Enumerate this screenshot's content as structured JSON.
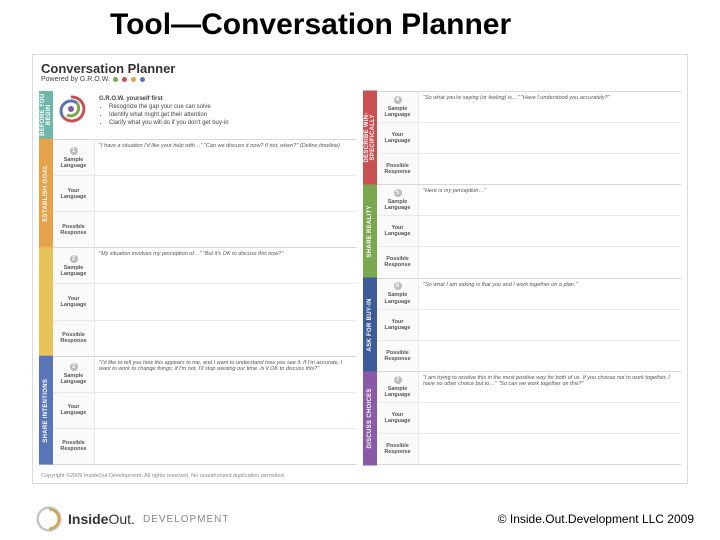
{
  "slide": {
    "title": "Tool—Conversation Planner"
  },
  "doc": {
    "header_title": "Conversation Planner",
    "header_sub": "Powered by G.R.O.W.",
    "intro_title": "G.R.O.W. yourself first",
    "intro_b1": "Recognize the gap your cue can solve",
    "intro_b2": "Identify what might get their attention",
    "intro_b3": "Clarify what you will do if you don't get buy-in",
    "before_label": "BEFORE YOU BEGIN",
    "labels": {
      "sample": "Sample Language",
      "your": "Your Language",
      "possible": "Possible Response"
    },
    "left": [
      {
        "num": "1",
        "tab": "ESTABLISH GOAL",
        "color": "c-orange",
        "sample": "\"I have a situation I'd like your help with…\"  \"Can we discuss it now? If not, when?\" (Define timeline)"
      },
      {
        "num": "2",
        "tab": "",
        "color": "c-yellow",
        "sample": "\"My situation involves my perception of…\"  \"But it's OK to discuss this now?\""
      },
      {
        "num": "3",
        "tab": "SHARE INTENTIONS",
        "color": "c-blue",
        "sample": "\"I'd like to tell you how this appears to me, and I want to understand how you see it. If I'm accurate, I want to work to change things; if I'm not, I'll stop wasting our time. Is it OK to discuss this?\""
      }
    ],
    "right": [
      {
        "num": "4",
        "tab": "DESCRIBE WIN-SPECIFICALLY",
        "color": "c-red",
        "sample": "\"So what you're saying (or feeling) is…\"  \"Have I understood you accurately?\""
      },
      {
        "num": "5",
        "tab": "SHARE REALITY",
        "color": "c-green",
        "sample": "\"Here is my perception…\""
      },
      {
        "num": "6",
        "tab": "ASK FOR BUY-IN",
        "color": "c-navy",
        "sample": "\"So what I am asking is that you and I work together on a plan.\""
      },
      {
        "num": "7",
        "tab": "DISCUSS CHOICES",
        "color": "c-purple",
        "sample": "\"I am trying to resolve this in the most positive way for both of us. If you choose not to work together, I have no other choice but to…\"  \"So can we work together on this?\""
      }
    ],
    "doc_copyright": "Copyright ©2009 InsideOut Development. All rights reserved. No unauthorized duplication permitted."
  },
  "footer": {
    "logo1a": "Inside",
    "logo1b": "Out.",
    "logo2": "DEVELOPMENT",
    "copyright": "© Inside.Out.Development LLC 2009"
  }
}
